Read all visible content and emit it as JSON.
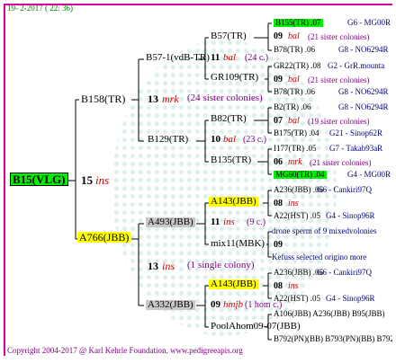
{
  "header": {
    "date": "19-  2-2017  ( 22: 36)"
  },
  "root": {
    "name": "B15(VLG)",
    "year": "15",
    "breeder": "ins"
  },
  "gen1": {
    "sire": "B158(TR)",
    "dam": "A766(JBB)"
  },
  "b158": {
    "year": "13",
    "breeder": "mrk",
    "sisters": "(24 sister colonies)"
  },
  "b57": {
    "name": "B57-1(vdB-TR)",
    "year": "11",
    "breeder": "bal",
    "count": "(24 c.)"
  },
  "b129": {
    "name": "B129(TR)",
    "year": "10",
    "breeder": "bal",
    "count": "(23 c.)"
  },
  "a766": {
    "year": "13",
    "breeder": "ins",
    "count": "(1 single colony)"
  },
  "a493": {
    "name": "A493(JBB)",
    "year": "11",
    "breeder": "ins",
    "count": "(9 c.)"
  },
  "a332": {
    "name": "A332(JBB)",
    "year": "09",
    "breeder": "hmjb",
    "count": "(1 hom c.)"
  },
  "g3": {
    "b57tr": "B57(TR)",
    "gr109": "GR109(TR)",
    "b82": "B82(TR)",
    "b135": "B135(TR)",
    "a143a": "A143(JBB)",
    "mix11": "mix11(MBK)",
    "a143b": "A143(JBB)",
    "poolahom": "PoolAhom09-07(JBB)"
  },
  "g4": {
    "r1": {
      "name": "B155(TR) .07",
      "dam": "G6 - MG00R"
    },
    "r2": {
      "year": "09",
      "breeder": "bal",
      "count": "(21 sister colonies)"
    },
    "r3": {
      "name": "B78(TR) .06",
      "dam": "G8 - NO6294R"
    },
    "r4": {
      "name": "GR22(TR) .08",
      "dam": "G2 - GrR.mounta"
    },
    "r5": {
      "year": "09",
      "breeder": "bal",
      "count": "(21 sister colonies)"
    },
    "r6": {
      "name": "B78(TR) .06",
      "dam": "G8 - NO6294R"
    },
    "r7": {
      "name": "B2(TR) .06",
      "dam": "G8 - NO6294R"
    },
    "r8": {
      "year": "07",
      "breeder": "bal",
      "count": "(19 sister colonies)"
    },
    "r9": {
      "name": "B175(TR) .04",
      "dam": "G21 - Sinop62R"
    },
    "r10": {
      "name": "I177(TR) .05",
      "dam": "G7 - Takab93aR"
    },
    "r11": {
      "year": "06",
      "breeder": "mrk",
      "count": "(21 sister colonies)"
    },
    "r12": {
      "name": "MG60(TR) .04",
      "dam": "G4 - MG00R"
    },
    "r13": {
      "name": "A236(JBB) .06",
      "dam": "G6 - Cankiri97Q"
    },
    "r14": {
      "year": "08",
      "breeder": "ins"
    },
    "r15": {
      "name": "A22(HST) .05",
      "dam": "G4 - Sinop96R"
    },
    "r16": {
      "name": "drone sperm of 9 mixedvolonies"
    },
    "r17": {
      "year": "09"
    },
    "r18": {
      "name": "Kefuss selected origino more"
    },
    "r19": {
      "name": "A236(JBB) .06",
      "dam": "G6 - Cankiri97Q"
    },
    "r20": {
      "year": "08",
      "breeder": "ins"
    },
    "r21": {
      "name": "A22(HST) .05",
      "dam": "G4 - Sinop96R"
    },
    "r22": {
      "name": "A106(JBB) A236(JBB) B95(JBB)"
    },
    "r23": {
      "name": "B792(PN)(BB) B793(PN)(BB) B792(PN)"
    }
  },
  "footer": {
    "text": "Copyright 2004-2017 @ Karl Kehrle Foundation.   www.pedigreeapis.org"
  }
}
